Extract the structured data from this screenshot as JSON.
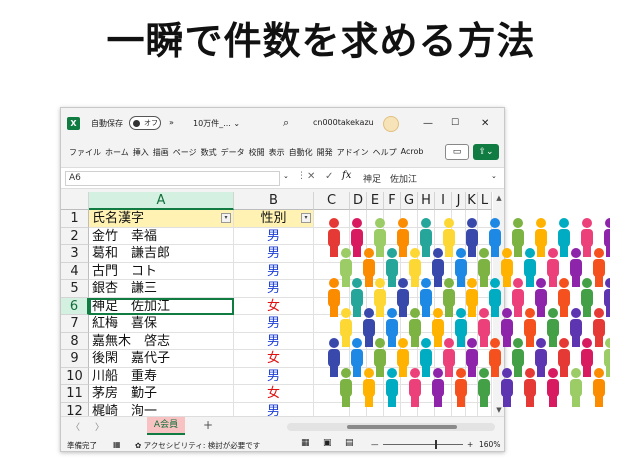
{
  "headline": "一瞬で件数を求める方法",
  "titlebar": {
    "app_icon": "excel-logo-icon",
    "autosave_label": "自動保存",
    "autosave_state": "オフ",
    "more_label": "»",
    "filename": "10万件_... ⌄",
    "search_icon": "search-icon",
    "user": "cn000takekazu",
    "min_label": "—",
    "max_label": "☐",
    "close_label": "✕"
  },
  "ribbon": {
    "tabs": [
      "ファイル",
      "ホーム",
      "挿入",
      "描画",
      "ページ",
      "数式",
      "データ",
      "校閲",
      "表示",
      "自動化",
      "開発",
      "アドイン",
      "ヘルプ",
      "Acrob"
    ],
    "comment_label": "▭",
    "share_label": "⇪⌄"
  },
  "formula_bar": {
    "name_box": "A6",
    "name_box_arrow": "⌄",
    "dots": "⋮",
    "cancel": "✕",
    "enter": "✓",
    "fx": "fx",
    "content": "神足　佐加江",
    "expand": "⌄"
  },
  "grid": {
    "columns": [
      "A",
      "B",
      "C",
      "D",
      "E",
      "F",
      "G",
      "H",
      "I",
      "J",
      "K",
      "L"
    ],
    "selected_column": "A",
    "selected_row": 6,
    "header_row": {
      "num": "1",
      "a": "氏名漢字",
      "b": "性別"
    },
    "filter_glyph": "▾",
    "rows": [
      {
        "num": "2",
        "a": "金竹　幸福",
        "b": "男",
        "g": "male"
      },
      {
        "num": "3",
        "a": "葛和　謙吉郎",
        "b": "男",
        "g": "male"
      },
      {
        "num": "4",
        "a": "古門　コト",
        "b": "男",
        "g": "male"
      },
      {
        "num": "5",
        "a": "銀杏　謙三",
        "b": "男",
        "g": "male"
      },
      {
        "num": "6",
        "a": "神足　佐加江",
        "b": "女",
        "g": "female"
      },
      {
        "num": "7",
        "a": "紅梅　喜保",
        "b": "男",
        "g": "male"
      },
      {
        "num": "8",
        "a": "嘉無木　啓志",
        "b": "男",
        "g": "male"
      },
      {
        "num": "9",
        "a": "後閑　嘉代子",
        "b": "女",
        "g": "female"
      },
      {
        "num": "10",
        "a": "川船　重寿",
        "b": "男",
        "g": "male"
      },
      {
        "num": "11",
        "a": "茅房　勤子",
        "b": "女",
        "g": "female"
      },
      {
        "num": "12",
        "a": "梶崎　洵一",
        "b": "男",
        "g": "male"
      }
    ]
  },
  "scroll": {
    "up": "▲",
    "down": "▼"
  },
  "sheetbar": {
    "prev": "〈",
    "next": "〉",
    "sheet_name": "A会員",
    "add": "+"
  },
  "statusbar": {
    "ready": "準備完了",
    "macro_icon": "▦",
    "accessibility": "✿ アクセシビリティ: 検討が必要です",
    "normal_view": "▦",
    "page_layout": "▣",
    "page_break": "▤",
    "minus": "—",
    "plus": "+",
    "zoom": "160%"
  },
  "colors": {
    "excel_green": "#107c41",
    "male_text": "#1f3fd6",
    "female_text": "#e01010",
    "header_fill": "#fff2b3",
    "sheet_tab": "#f9c2c2",
    "crowd": [
      "#e53935",
      "#1e88e5",
      "#43a047",
      "#fdd835",
      "#8e24aa",
      "#fb8c00",
      "#00acc1",
      "#d81b60",
      "#7cb342",
      "#5e35b1",
      "#3949ab",
      "#f4511e",
      "#26a69a",
      "#ec407a",
      "#9ccc65",
      "#ffb300"
    ]
  }
}
